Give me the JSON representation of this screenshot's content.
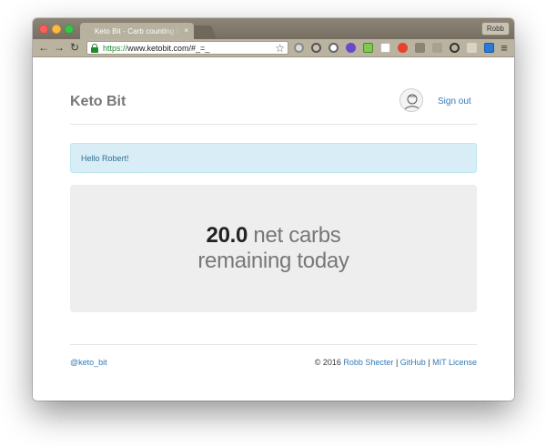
{
  "browser": {
    "tab_title": "Keto Bit - Carb counting for",
    "tab_close": "×",
    "profile_name": "Robb",
    "url_scheme": "https://",
    "url_rest": "www.ketobit.com/#_=_",
    "icons": {
      "back": "back-arrow-icon",
      "forward": "forward-arrow-icon",
      "reload": "reload-icon",
      "star": "bookmark-star-icon",
      "menu": "hamburger-menu-icon"
    },
    "glyphs": {
      "back": "←",
      "forward": "→",
      "reload": "↻",
      "star": "☆",
      "menu": "≡"
    }
  },
  "site": {
    "brand": "Keto Bit",
    "sign_out": "Sign out",
    "greeting": "Hello Robert!",
    "carbs_value": "20.0",
    "carbs_suffix": " net carbs",
    "carbs_line2": "remaining today",
    "footer_handle": "@keto_bit",
    "footer_copyright": "© 2016 ",
    "footer_author": "Robb Shecter",
    "footer_github": "GitHub",
    "footer_license": "MIT License",
    "footer_sep": " | "
  },
  "colors": {
    "link": "#337ab7",
    "alert_bg": "#d9edf7",
    "jumbotron_bg": "#eeeeee",
    "brand_text": "#777777"
  }
}
